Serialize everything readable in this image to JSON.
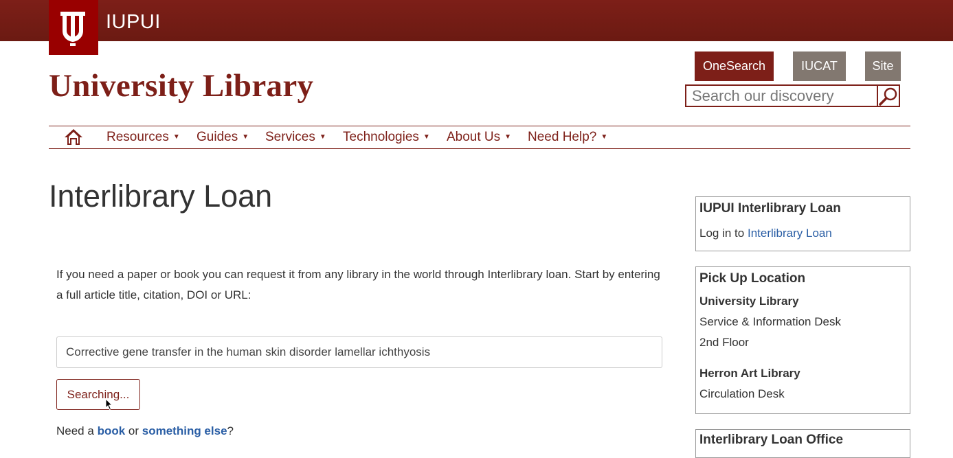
{
  "header": {
    "org_name": "IUPUI",
    "site_title": "University Library",
    "brand_color": "#7d1f18"
  },
  "search": {
    "tabs": [
      "OneSearch",
      "IUCAT",
      "Site"
    ],
    "placeholder": "Search our discovery",
    "submit_icon": "magnifier-icon"
  },
  "nav": {
    "home_icon": "home-icon",
    "items": [
      "Resources",
      "Guides",
      "Services",
      "Technologies",
      "About Us",
      "Need Help?"
    ]
  },
  "main": {
    "title": "Interlibrary Loan",
    "intro": "If you need a paper or book you can request it from any library in the world through Interlibrary loan. Start by entering a full article title, citation, DOI or URL:",
    "citation_value": "Corrective gene transfer in the human skin disorder lamellar ichthyosis",
    "button_label": "Searching...",
    "need_prefix": "Need a",
    "need_book": "book",
    "need_or": "or",
    "need_else": "something else",
    "need_suffix": "?"
  },
  "sidebar": {
    "ill": {
      "title": "IUPUI Interlibrary Loan",
      "login_prefix": "Log in to",
      "login_link": "Interlibrary Loan"
    },
    "pickup": {
      "title": "Pick Up Location",
      "loc1_name": "University Library",
      "loc1_line1": "Service & Information Desk",
      "loc1_line2": "2nd Floor",
      "loc2_name": "Herron Art Library",
      "loc2_line1": "Circulation Desk"
    },
    "office": {
      "title": "Interlibrary Loan Office"
    }
  }
}
